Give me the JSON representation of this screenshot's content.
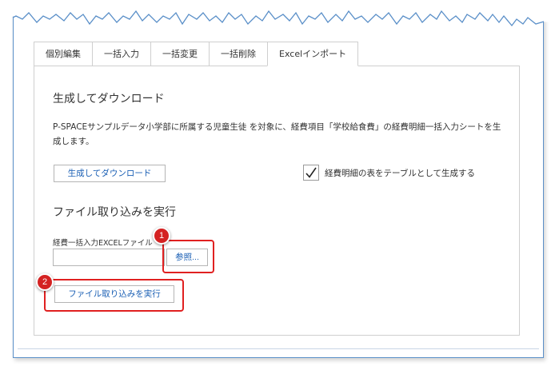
{
  "tabs": [
    {
      "label": "個別編集"
    },
    {
      "label": "一括入力"
    },
    {
      "label": "一括変更"
    },
    {
      "label": "一括削除"
    },
    {
      "label": "Excelインポート",
      "active": true
    }
  ],
  "generate": {
    "title": "生成してダウンロード",
    "description": "P-SPACEサンプルデータ小学部に所属する児童生徒 を対象に、経費項目「学校給食費」の経費明細一括入力シートを生成します。",
    "button_label": "生成してダウンロード",
    "checkbox_label": "経費明細の表をテーブルとして生成する",
    "checkbox_checked": true
  },
  "import": {
    "title": "ファイル取り込みを実行",
    "file_label": "経費一括入力EXCELファイル",
    "file_value": "",
    "browse_label": "参照...",
    "execute_label": "ファイル取り込みを実行"
  },
  "annotations": [
    {
      "number": "1"
    },
    {
      "number": "2"
    }
  ],
  "colors": {
    "frame_border": "#5a8fc8",
    "link_blue": "#1a5fb4",
    "highlight_red": "#e02020",
    "marker_red": "#d42222"
  }
}
